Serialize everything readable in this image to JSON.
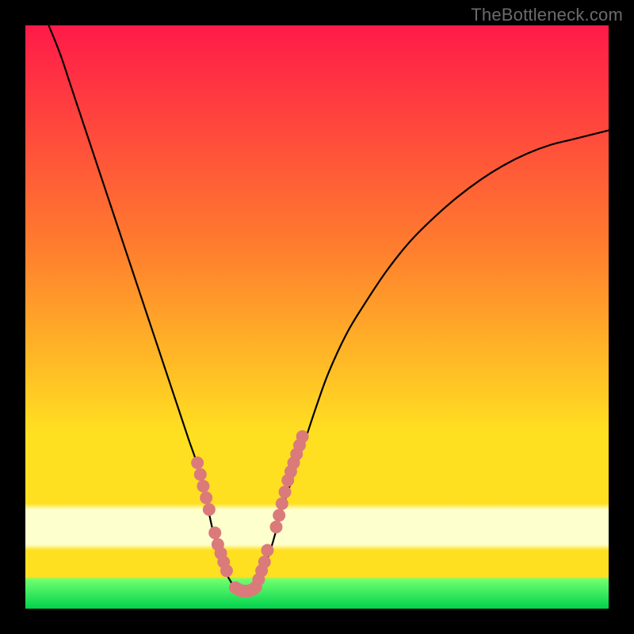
{
  "watermark": "TheBottleneck.com",
  "colors": {
    "frame": "#000000",
    "gradient_top": "#ff1a49",
    "gradient_mid1": "#ff7d2e",
    "gradient_mid2": "#ffe021",
    "gradient_band_light": "#fdffcc",
    "gradient_green_top": "#6fff6f",
    "gradient_green_bottom": "#00d24d",
    "curve": "#000000",
    "marker": "#db7a7b"
  },
  "chart_data": {
    "type": "line",
    "title": "",
    "xlabel": "",
    "ylabel": "",
    "xlim": [
      0,
      100
    ],
    "ylim": [
      0,
      100
    ],
    "grid": false,
    "legend": false,
    "series": [
      {
        "name": "bottleneck-curve",
        "x": [
          4,
          6,
          8,
          10,
          12,
          14,
          16,
          18,
          20,
          22,
          24,
          26,
          28,
          30,
          32,
          33,
          34,
          35,
          36,
          37,
          38,
          39,
          40,
          42,
          44,
          46,
          48,
          50,
          52,
          55,
          58,
          62,
          66,
          70,
          74,
          78,
          82,
          86,
          90,
          94,
          98,
          100
        ],
        "y": [
          100,
          95,
          89,
          83,
          77,
          71,
          65,
          59,
          53,
          47,
          41,
          35,
          29,
          23,
          14,
          10,
          7,
          5,
          3.5,
          3,
          3,
          3.5,
          5,
          10,
          17,
          23,
          29,
          35,
          40.5,
          47,
          52,
          58,
          63,
          67,
          70.5,
          73.5,
          76,
          78,
          79.5,
          80.5,
          81.5,
          82
        ]
      }
    ],
    "markers": {
      "name": "highlighted-band",
      "x": [
        29.5,
        30,
        30.5,
        31,
        31.5,
        32.5,
        33,
        33.5,
        34,
        34.5,
        36,
        36.5,
        37,
        37.5,
        38,
        38.5,
        39,
        39.5,
        40,
        40.5,
        41,
        41.5,
        43,
        43.5,
        44,
        44.5,
        45,
        45.5,
        46,
        46.5,
        47,
        47.5
      ],
      "y": [
        25,
        23,
        21,
        19,
        17,
        13,
        11,
        9.5,
        8,
        6.5,
        3.6,
        3.3,
        3.1,
        3,
        3,
        3.1,
        3.3,
        3.7,
        5,
        6.5,
        8,
        10,
        14,
        16,
        18,
        20,
        22,
        23.5,
        25,
        26.5,
        28,
        29.5
      ]
    },
    "marker_radius": 8,
    "bands": [
      {
        "name": "light-band",
        "y0": 17,
        "y1": 11
      },
      {
        "name": "green-band",
        "y0": 5,
        "y1": 0
      }
    ]
  }
}
